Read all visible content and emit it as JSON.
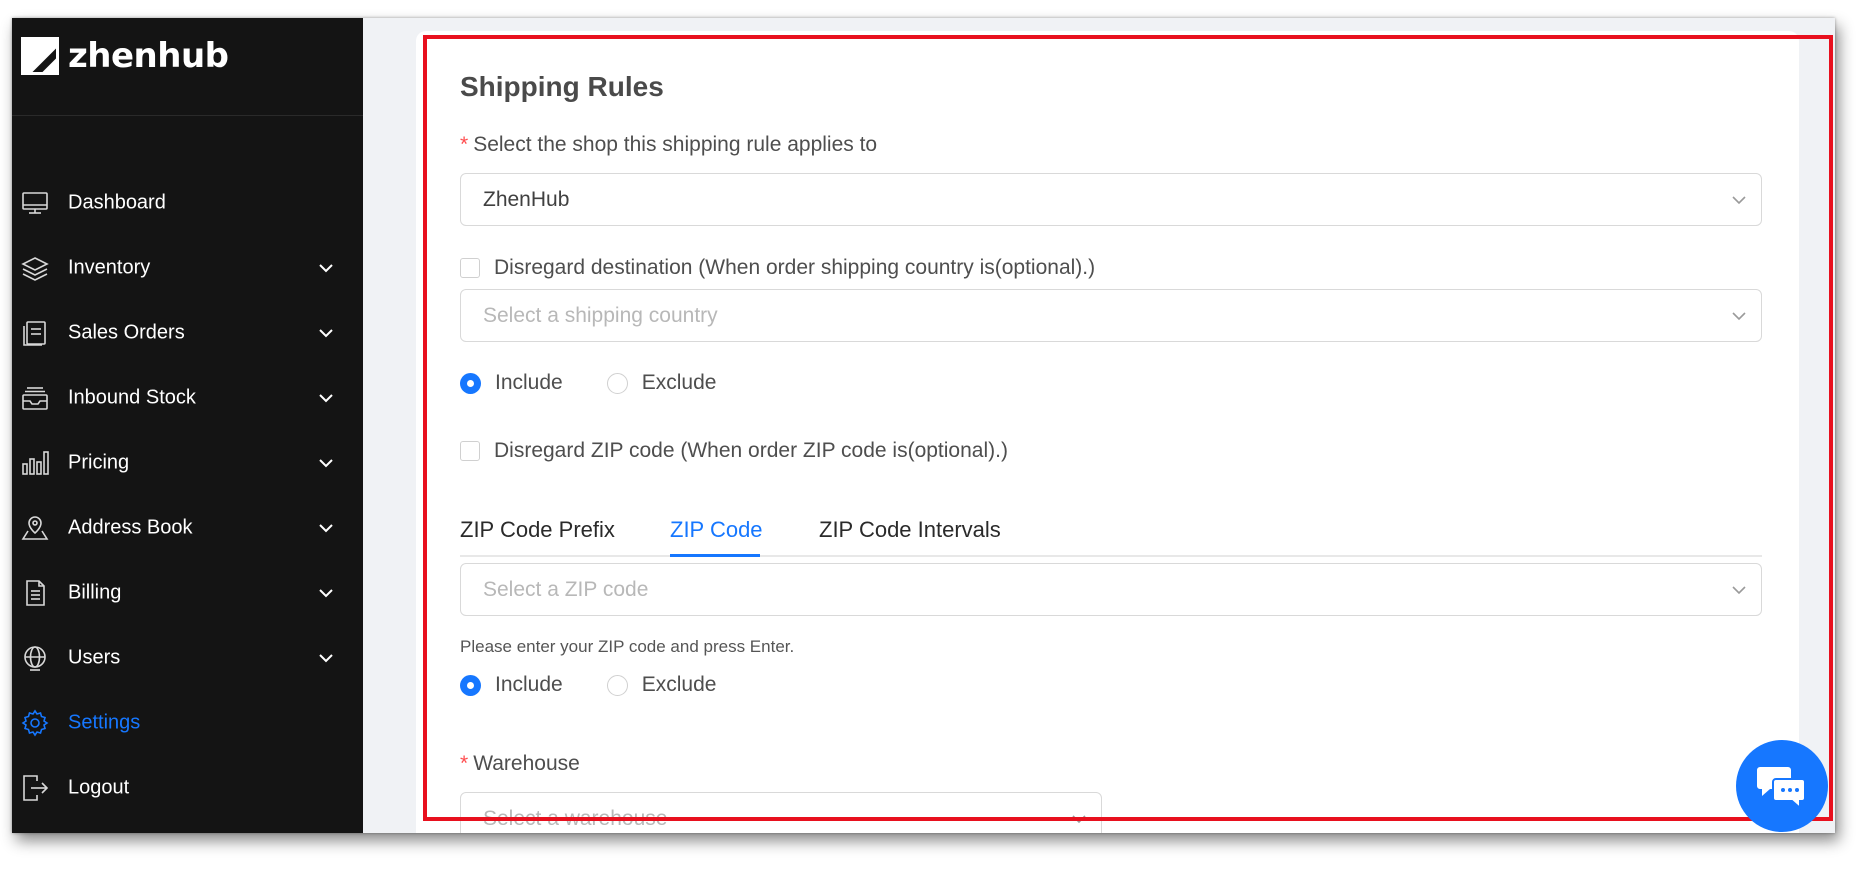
{
  "app": {
    "name": "zhenhub"
  },
  "sidebar": {
    "items": [
      {
        "label": "Dashboard",
        "icon": "monitor-icon",
        "has_submenu": false
      },
      {
        "label": "Inventory",
        "icon": "layers-icon",
        "has_submenu": true
      },
      {
        "label": "Sales Orders",
        "icon": "document-stack-icon",
        "has_submenu": true
      },
      {
        "label": "Inbound Stock",
        "icon": "inbox-tray-icon",
        "has_submenu": true
      },
      {
        "label": "Pricing",
        "icon": "bar-chart-icon",
        "has_submenu": true
      },
      {
        "label": "Address Book",
        "icon": "map-pin-icon",
        "has_submenu": true
      },
      {
        "label": "Billing",
        "icon": "invoice-icon",
        "has_submenu": true
      },
      {
        "label": "Users",
        "icon": "globe-user-icon",
        "has_submenu": true
      },
      {
        "label": "Settings",
        "icon": "gear-icon",
        "has_submenu": false,
        "active": true
      },
      {
        "label": "Logout",
        "icon": "logout-icon",
        "has_submenu": false
      }
    ]
  },
  "form": {
    "title": "Shipping Rules",
    "shop": {
      "label": "Select the shop this shipping rule applies to",
      "required": true,
      "value": "ZhenHub"
    },
    "destination": {
      "checkbox_label": "Disregard destination (When order shipping country is(optional).)",
      "checked": false,
      "placeholder": "Select a shipping country",
      "radio_include": "Include",
      "radio_exclude": "Exclude",
      "selected": "Include"
    },
    "zip": {
      "checkbox_label": "Disregard ZIP code (When order ZIP code is(optional).)",
      "checked": false,
      "tabs": [
        "ZIP Code Prefix",
        "ZIP Code",
        "ZIP Code Intervals"
      ],
      "active_tab": "ZIP Code",
      "placeholder": "Select a ZIP code",
      "help_text": "Please enter your ZIP code and press Enter.",
      "radio_include": "Include",
      "radio_exclude": "Exclude",
      "selected": "Include"
    },
    "warehouse": {
      "label": "Warehouse",
      "required": true,
      "placeholder": "Select a warehouse"
    }
  },
  "colors": {
    "sidebar_bg": "#141414",
    "accent": "#1677ff",
    "required": "#ff4d4f",
    "highlight": "#e8101e"
  },
  "chat": {
    "icon": "chat-bubbles-icon"
  }
}
